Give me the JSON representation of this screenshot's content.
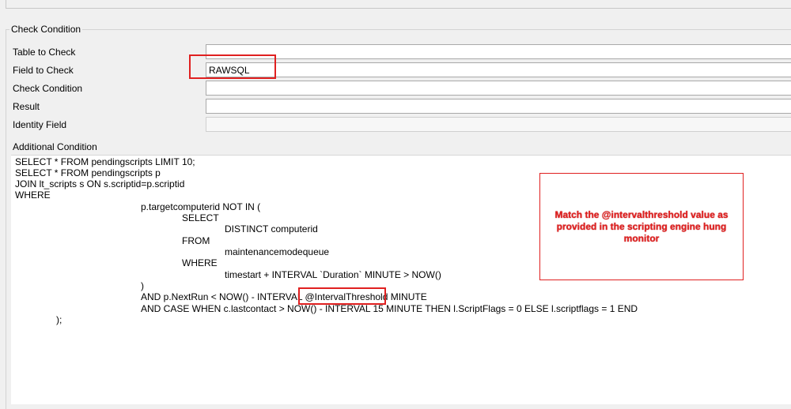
{
  "group": {
    "title": "Check Condition"
  },
  "fields": [
    {
      "label": "Table to Check",
      "value": ""
    },
    {
      "label": "Field to Check",
      "value": "RAWSQL"
    },
    {
      "label": "Check Condition",
      "value": ""
    },
    {
      "label": "Result",
      "value": ""
    },
    {
      "label": "Identity Field",
      "value": ""
    }
  ],
  "additional": {
    "label": "Additional Condition",
    "lines": [
      "SELECT * FROM pendingscripts LIMIT 10;",
      "SELECT * FROM pendingscripts p",
      "JOIN lt_scripts s ON s.scriptid=p.scriptid",
      "WHERE",
      "p.targetcomputerid NOT IN (",
      "SELECT",
      "DISTINCT computerid",
      "FROM",
      "maintenancemodequeue",
      "WHERE",
      "timestart + INTERVAL `Duration` MINUTE > NOW()",
      ")",
      "AND p.NextRun < NOW() - INTERVAL @IntervalThreshold MINUTE",
      "AND CASE WHEN c.lastcontact > NOW() - INTERVAL 15 MINUTE THEN l.ScriptFlags = 0 ELSE l.scriptflags = 1 END",
      ");"
    ]
  },
  "callout": {
    "text": "Match the @intervalthreshold value as provided in the scripting engine hung monitor"
  },
  "colors": {
    "annotation_red": "#e02020"
  }
}
